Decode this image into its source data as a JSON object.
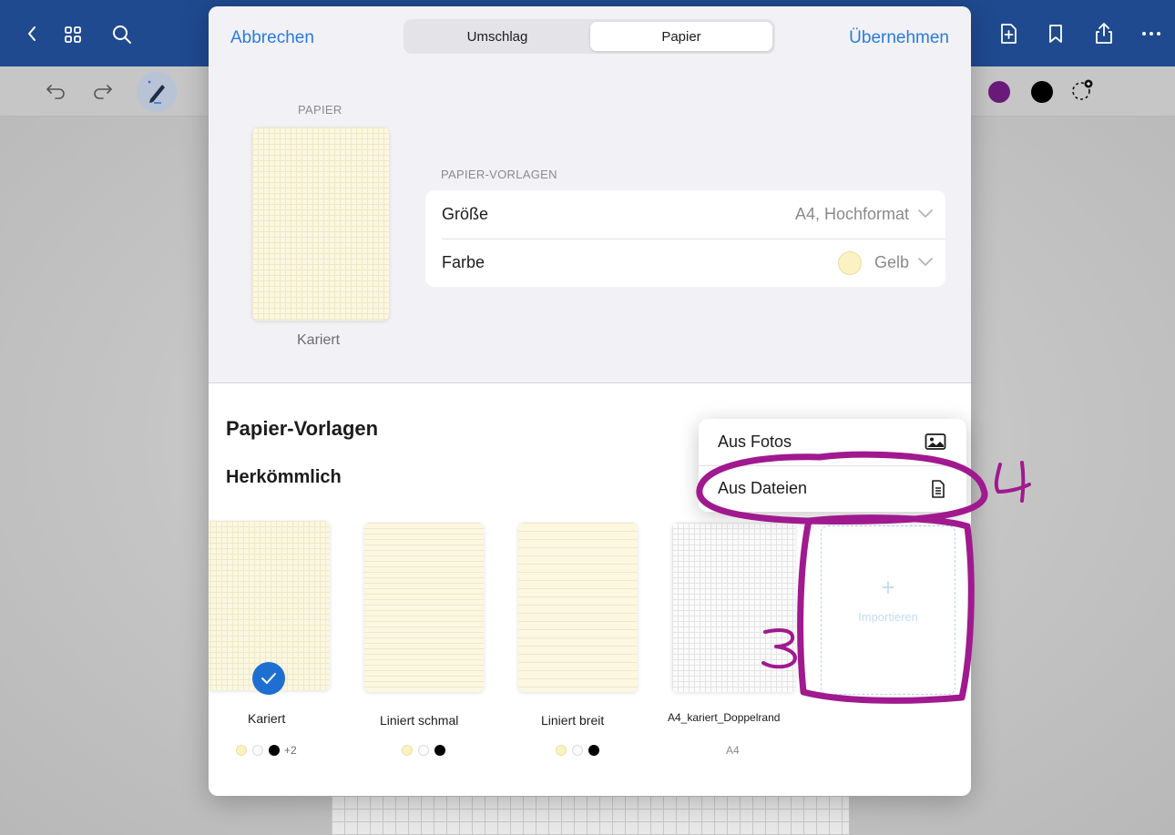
{
  "topbar": {
    "icons": [
      "chevron-left-icon",
      "grid-icon",
      "search-icon",
      "add-page-icon",
      "bookmark-icon",
      "share-icon",
      "more-icon"
    ]
  },
  "toolbar": {
    "icons": [
      "undo-icon",
      "redo-icon",
      "pen-icon",
      "lasso-add-icon"
    ],
    "colors": [
      "#6a1b7a",
      "#000000"
    ]
  },
  "modal": {
    "cancel_label": "Abbrechen",
    "apply_label": "Übernehmen",
    "tabs": [
      {
        "label": "Umschlag",
        "active": false
      },
      {
        "label": "Papier",
        "active": true
      }
    ],
    "preview": {
      "section_label": "PAPIER",
      "name": "Kariert"
    },
    "templates_group_label": "PAPIER-VORLAGEN",
    "settings": [
      {
        "label": "Größe",
        "value": "A4, Hochformat"
      },
      {
        "label": "Farbe",
        "value": "Gelb",
        "swatch": "#fbf2c4"
      }
    ],
    "section_title": "Papier-Vorlagen",
    "subsection_title": "Herkömmlich",
    "templates": [
      {
        "name": "Kariert",
        "selected": true,
        "extra": "+2"
      },
      {
        "name": "Liniert schmal",
        "selected": false
      },
      {
        "name": "Liniert breit",
        "selected": false
      },
      {
        "name": "A4_kariert_Doppelrand",
        "selected": false,
        "subtitle": "A4"
      }
    ],
    "import_label": "Importieren"
  },
  "popover": {
    "items": [
      {
        "label": "Aus Fotos",
        "icon": "photo-icon"
      },
      {
        "label": "Aus Dateien",
        "icon": "document-icon"
      }
    ]
  },
  "annotations": {
    "step_3": "3",
    "step_4": "4",
    "ink_color": "#a0198f"
  }
}
